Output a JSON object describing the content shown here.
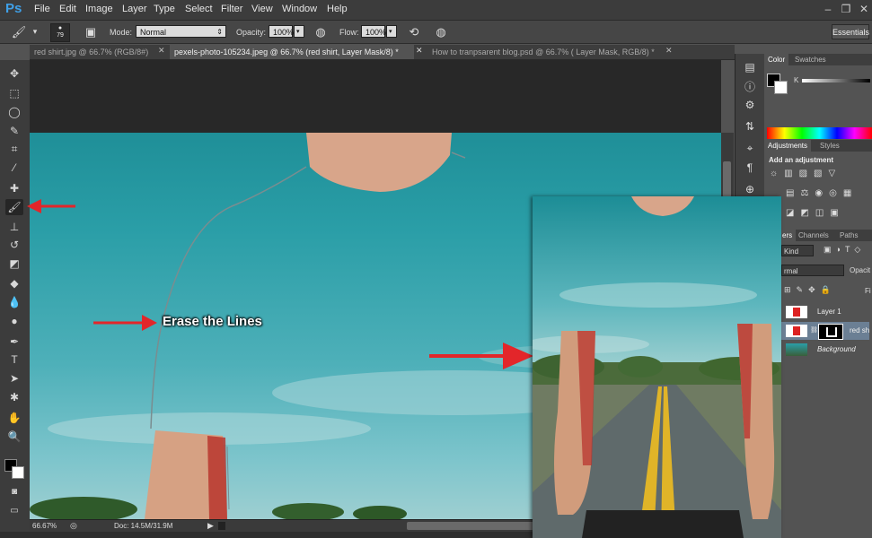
{
  "app": {
    "logo": "Ps"
  },
  "menu": [
    "File",
    "Edit",
    "Image",
    "Layer",
    "Type",
    "Select",
    "Filter",
    "View",
    "Window",
    "Help"
  ],
  "window_buttons": [
    "–",
    "❐",
    "✕"
  ],
  "options": {
    "brush_size": "79",
    "mode_label": "Mode:",
    "mode_value": "Normal",
    "opacity_label": "Opacity:",
    "opacity_value": "100%",
    "flow_label": "Flow:",
    "flow_value": "100%",
    "workspace": "Essentials"
  },
  "tabs": [
    {
      "label": "red shirt.jpg @ 66.7% (RGB/8#)",
      "active": false
    },
    {
      "label": "pexels-photo-105234.jpeg @ 66.7% (red shirt, Layer Mask/8) *",
      "active": true
    },
    {
      "label": "How to tranpsarent blog.psd @ 66.7% ( Layer Mask, RGB/8) *",
      "active": false
    }
  ],
  "tools": [
    {
      "name": "move-tool-icon",
      "glyph": "✥"
    },
    {
      "name": "marquee-tool-icon",
      "glyph": "⬚"
    },
    {
      "name": "lasso-tool-icon",
      "glyph": "◯"
    },
    {
      "name": "quick-select-tool-icon",
      "glyph": "✎"
    },
    {
      "name": "crop-tool-icon",
      "glyph": "⌗"
    },
    {
      "name": "eyedropper-tool-icon",
      "glyph": "⁄"
    },
    {
      "name": "healing-tool-icon",
      "glyph": "✚"
    },
    {
      "name": "brush-tool-icon",
      "glyph": "🖌"
    },
    {
      "name": "stamp-tool-icon",
      "glyph": "⊥"
    },
    {
      "name": "history-brush-tool-icon",
      "glyph": "↺"
    },
    {
      "name": "eraser-tool-icon",
      "glyph": "◩"
    },
    {
      "name": "paint-bucket-tool-icon",
      "glyph": "◆"
    },
    {
      "name": "blur-tool-icon",
      "glyph": "💧"
    },
    {
      "name": "dodge-tool-icon",
      "glyph": "●"
    },
    {
      "name": "pen-tool-icon",
      "glyph": "✒"
    },
    {
      "name": "type-tool-icon",
      "glyph": "T"
    },
    {
      "name": "path-select-tool-icon",
      "glyph": "➤"
    },
    {
      "name": "shape-tool-icon",
      "glyph": "✱"
    },
    {
      "name": "hand-tool-icon",
      "glyph": "✋"
    },
    {
      "name": "zoom-tool-icon",
      "glyph": "🔍"
    }
  ],
  "status": {
    "zoom": "66.67%",
    "doc": "Doc: 14.5M/31.9M"
  },
  "annotations": {
    "erase": "Erase the Lines"
  },
  "panels": {
    "color_tab": "Color",
    "swatches_tab": "Swatches",
    "k_label": "K",
    "adjustments_tab": "Adjustments",
    "styles_tab": "Styles",
    "add_adjustment": "Add an adjustment",
    "layers_tab": "ers",
    "channels_tab": "Channels",
    "paths_tab": "Paths",
    "kind_filter": "Kind",
    "blend_mode": "rmal",
    "opacity_short": "Opacit",
    "fill_short": "Fi",
    "layers": [
      "Layer 1",
      "red sh",
      "Background"
    ]
  },
  "colors": {
    "accent_red": "#e3262a",
    "ps_blue": "#3fa0e8"
  }
}
